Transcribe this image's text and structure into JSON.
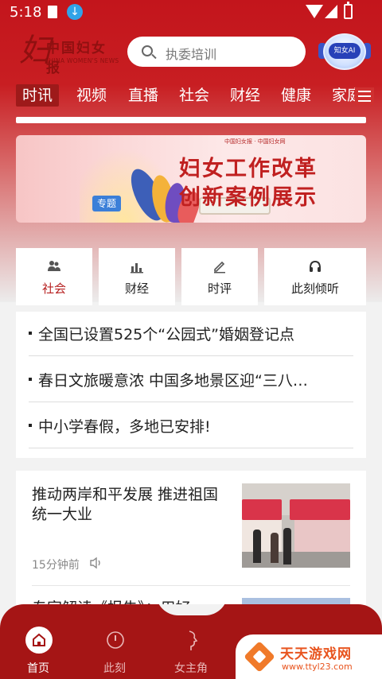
{
  "status_bar": {
    "time": "5:18"
  },
  "header": {
    "logo_mark": "妇",
    "logo_name": "中国妇女报",
    "logo_sub": "CHINA WOMEN'S NEWS",
    "search_placeholder": "执委培训",
    "ai_label": "知女AI"
  },
  "tabs": [
    {
      "label": "时讯",
      "active": true
    },
    {
      "label": "视频"
    },
    {
      "label": "直播"
    },
    {
      "label": "社会"
    },
    {
      "label": "财经"
    },
    {
      "label": "健康"
    },
    {
      "label": "家庭"
    }
  ],
  "banner": {
    "title_line1": "妇女工作改革",
    "title_line2": "创新案例展示",
    "tag": "专题",
    "small_logo": "中国妇女报 · 中国妇女网"
  },
  "quick_entries": [
    {
      "label": "社会",
      "icon": "people-icon",
      "active": true
    },
    {
      "label": "财经",
      "icon": "finance-chart-icon"
    },
    {
      "label": "时评",
      "icon": "pen-icon"
    },
    {
      "label": "此刻倾听",
      "icon": "headphones-icon"
    }
  ],
  "headlines": [
    "全国已设置525个“公园式”婚姻登记点",
    "春日文旅暖意浓 中国多地景区迎“三八…",
    "中小学春假，多地已安排!"
  ],
  "feed": [
    {
      "title": "推动两岸和平发展 推进祖国统一大业",
      "time": "15分钟前"
    },
    {
      "title": "专家解读《报告》：用好"
    }
  ],
  "bottom_nav": [
    {
      "label": "首页",
      "icon": "home-icon",
      "active": true
    },
    {
      "label": "此刻",
      "icon": "compass-icon"
    },
    {
      "label": "女主角",
      "icon": "woman-profile-icon"
    }
  ],
  "watermark": {
    "title": "天天游戏网",
    "url": "www.ttyl23.com"
  },
  "colors": {
    "brand_red": "#b72121",
    "nav_red": "#a51515",
    "tag_blue": "#3b7fd8"
  }
}
